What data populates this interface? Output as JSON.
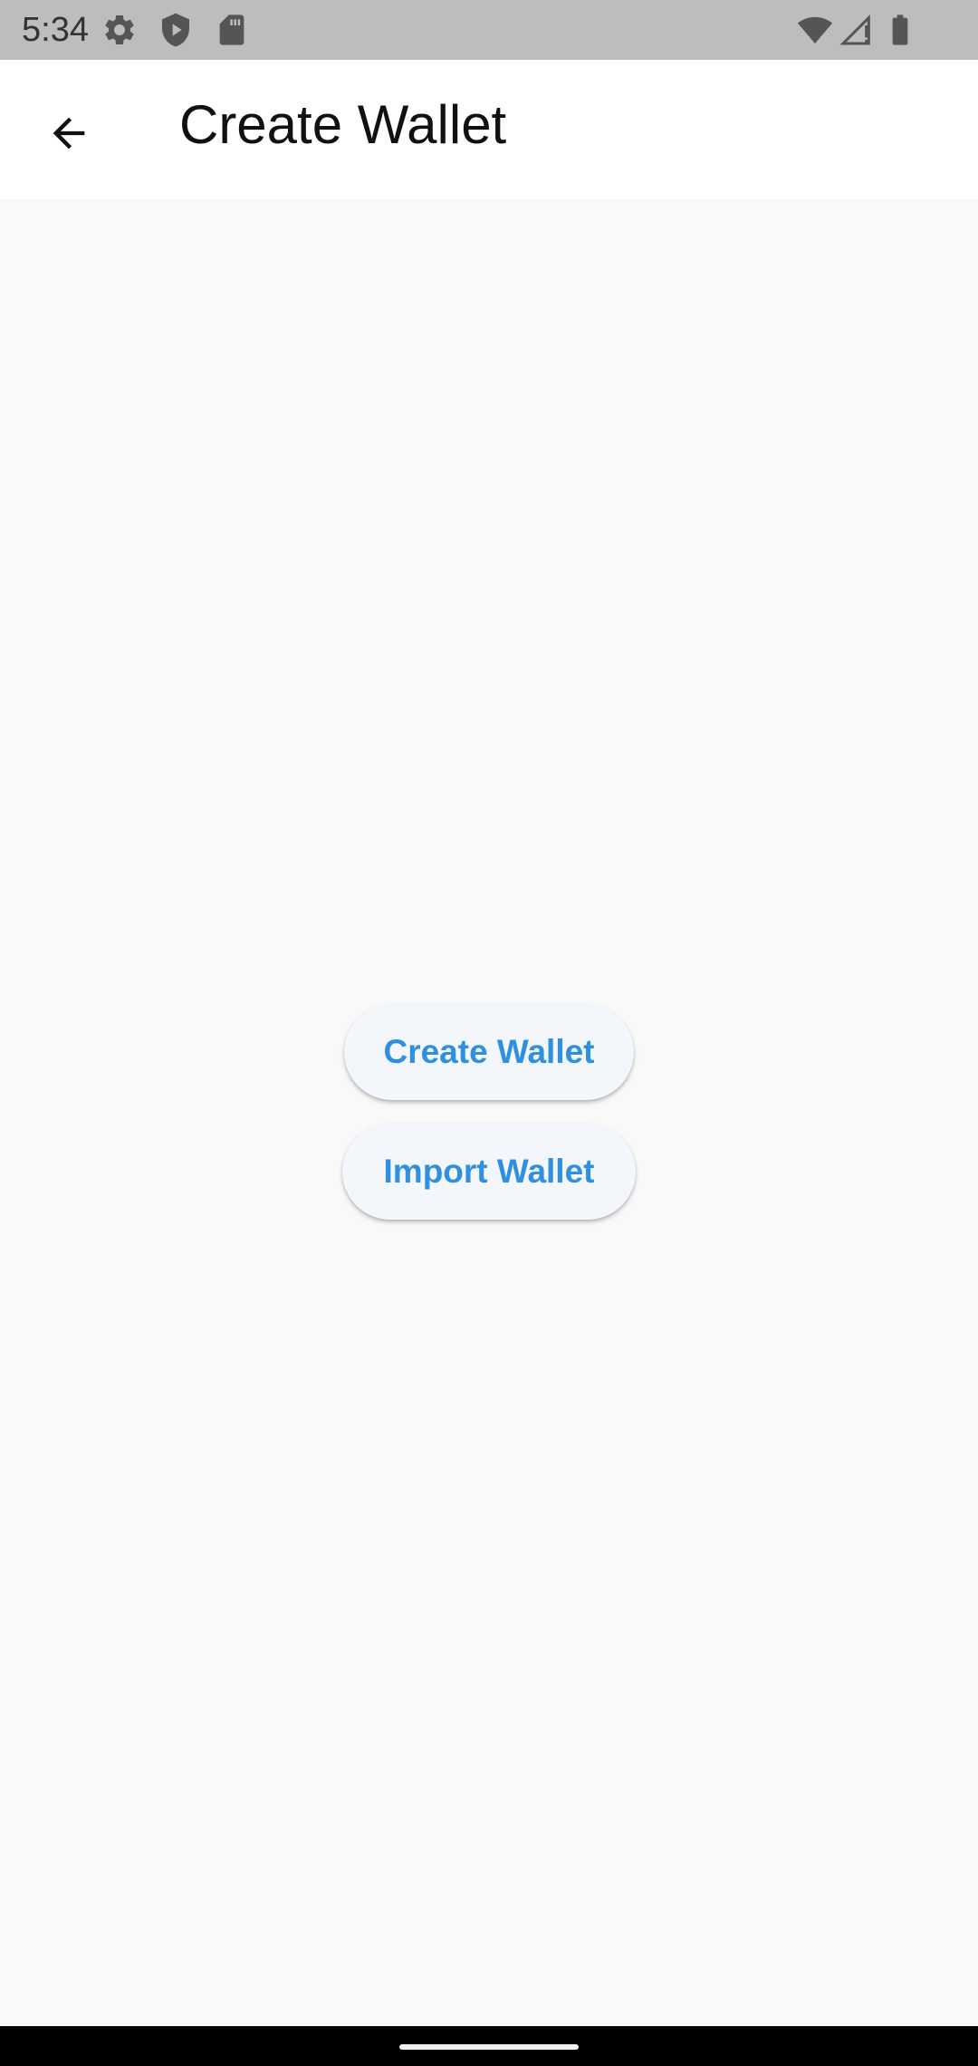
{
  "status_bar": {
    "time": "5:34",
    "left_icons": [
      "settings-icon",
      "shield-play-icon",
      "sd-card-icon"
    ],
    "right_icons": [
      "wifi-icon",
      "cell-signal-icon",
      "battery-icon"
    ]
  },
  "app_bar": {
    "back_icon": "arrow-back-icon",
    "title": "Create Wallet"
  },
  "actions": {
    "create_label": "Create Wallet",
    "import_label": "Import Wallet"
  },
  "colors": {
    "status_bar": "#bdbdbd",
    "app_bar": "#ffffff",
    "background": "#f9f9f9",
    "button_bg": "#f3f7fc",
    "button_text": "#2f8fe0",
    "nav_bar": "#000000"
  }
}
